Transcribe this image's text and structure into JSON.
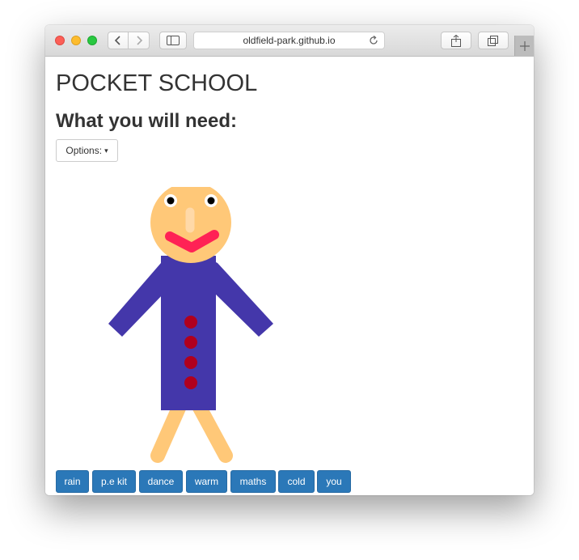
{
  "browser": {
    "url": "oldfield-park.github.io"
  },
  "page": {
    "title": "POCKET SCHOOL",
    "subtitle": "What you will need:",
    "options_label": "Options:",
    "options_caret": "▾"
  },
  "buttons": [
    "rain",
    "p.e kit",
    "dance",
    "warm",
    "maths",
    "cold",
    "you"
  ],
  "colors": {
    "skin": "#ffc878",
    "nose": "#ffd9a8",
    "mouth": "#ff2255",
    "coat": "#4437aa",
    "coat_buttons": "#b0001e",
    "button_bg": "#2b78b8"
  },
  "icons": [
    "back-chevron-icon",
    "forward-chevron-icon",
    "sidebar-icon",
    "reload-icon",
    "share-icon",
    "tabs-icon",
    "plus-icon"
  ]
}
